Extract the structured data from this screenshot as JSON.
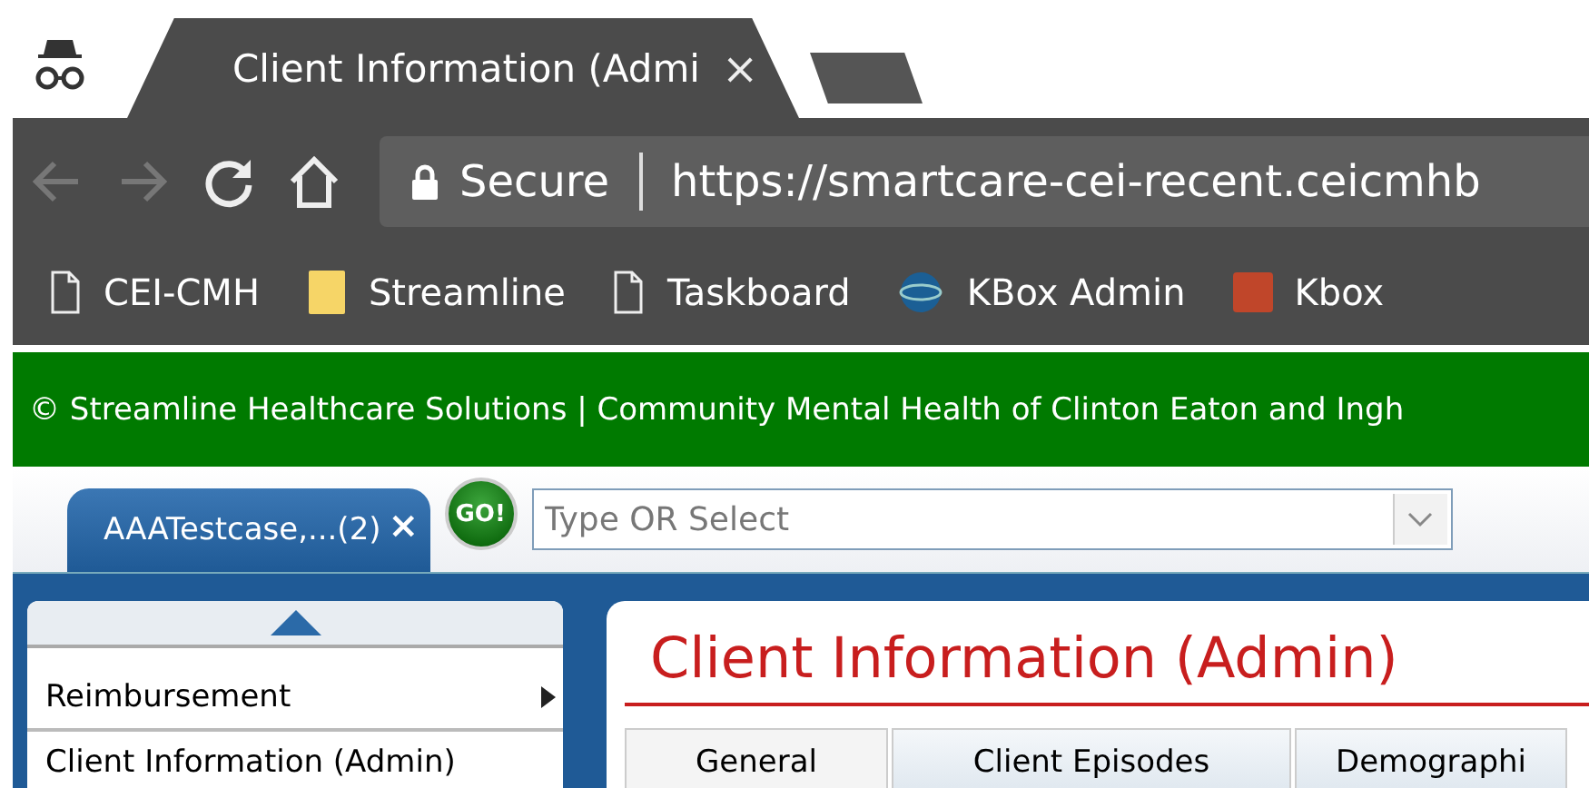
{
  "browser": {
    "tab_title": "Client Information (Admi",
    "tab_close": "×",
    "url_security": "Secure",
    "url": "https://smartcare-cei-recent.ceicmhb",
    "bookmarks": [
      {
        "kind": "page",
        "label": "CEI-CMH"
      },
      {
        "kind": "folder",
        "label": "Streamline"
      },
      {
        "kind": "page",
        "label": "Taskboard"
      },
      {
        "kind": "globe",
        "label": "KBox Admin"
      },
      {
        "kind": "tile",
        "label": "Kbox"
      }
    ]
  },
  "banner": "© Streamline Healthcare Solutions | Community Mental Health of Clinton Eaton and Ingh",
  "client_tab": {
    "label": "AAATestcase,...(2)",
    "close": "×"
  },
  "go_button": "GO!",
  "client_search": {
    "placeholder": "Type OR Select"
  },
  "menu": [
    {
      "label": "Reimbursement",
      "has_submenu": true
    },
    {
      "label": "Client Information (Admin)",
      "has_submenu": false
    }
  ],
  "page_title": "Client Information (Admin)",
  "page_tabs": [
    {
      "label": "General",
      "selected": true
    },
    {
      "label": "Client Episodes",
      "selected": false
    },
    {
      "label": "Demographi",
      "selected": false
    }
  ]
}
